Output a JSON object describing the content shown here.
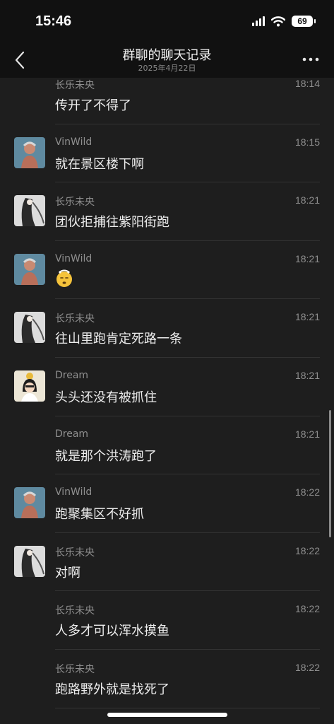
{
  "status": {
    "time": "15:46",
    "battery": "69"
  },
  "nav": {
    "title": "群聊的聊天记录",
    "date": "2025年4月22日"
  },
  "messages": [
    {
      "sender": "长乐未央",
      "time": "18:14",
      "text": "传开了不得了",
      "avatar": "none"
    },
    {
      "sender": "VinWild",
      "time": "18:15",
      "text": "就在景区楼下啊",
      "avatar": "vinwild"
    },
    {
      "sender": "长乐未央",
      "time": "18:21",
      "text": "团伙拒捕往紫阳街跑",
      "avatar": "changle"
    },
    {
      "sender": "VinWild",
      "time": "18:21",
      "text": "",
      "emoji": "dizzy-face-emoji",
      "avatar": "vinwild"
    },
    {
      "sender": "长乐未央",
      "time": "18:21",
      "text": "往山里跑肯定死路一条",
      "avatar": "changle"
    },
    {
      "sender": "Dream",
      "time": "18:21",
      "text": "头头还没有被抓住",
      "avatar": "dream"
    },
    {
      "sender": "Dream",
      "time": "18:21",
      "text": "就是那个洪涛跑了",
      "avatar": "none"
    },
    {
      "sender": "VinWild",
      "time": "18:22",
      "text": "跑聚集区不好抓",
      "avatar": "vinwild"
    },
    {
      "sender": "长乐未央",
      "time": "18:22",
      "text": "对啊",
      "avatar": "changle"
    },
    {
      "sender": "长乐未央",
      "time": "18:22",
      "text": "人多才可以浑水摸鱼",
      "avatar": "none"
    },
    {
      "sender": "长乐未央",
      "time": "18:22",
      "text": "跑路野外就是找死了",
      "avatar": "none"
    }
  ],
  "colors": {
    "background": "#1e1e1e",
    "header": "#111111",
    "secondary_text": "#8f8f8f"
  },
  "icons": {
    "back": "chevron-left-icon",
    "more": "more-dots-icon"
  }
}
